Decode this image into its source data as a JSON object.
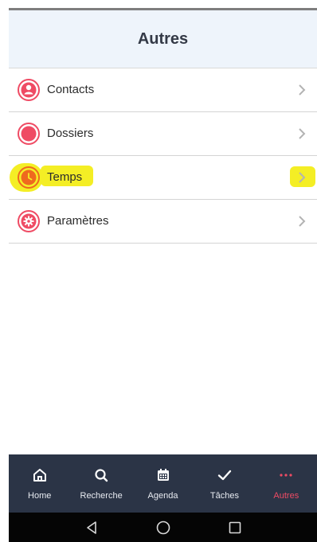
{
  "header": {
    "title": "Autres"
  },
  "menu": {
    "items": [
      {
        "label": "Contacts",
        "icon": "contacts-icon"
      },
      {
        "label": "Dossiers",
        "icon": "folder-icon"
      },
      {
        "label": "Temps",
        "icon": "clock-icon",
        "highlighted": true
      },
      {
        "label": "Paramètres",
        "icon": "settings-icon"
      }
    ]
  },
  "bottom_nav": {
    "items": [
      {
        "label": "Home",
        "icon": "home-icon"
      },
      {
        "label": "Recherche",
        "icon": "search-icon"
      },
      {
        "label": "Agenda",
        "icon": "calendar-icon"
      },
      {
        "label": "Tâches",
        "icon": "checkmark-icon"
      },
      {
        "label": "Autres",
        "icon": "more-dots-icon",
        "active": true
      }
    ]
  },
  "system_nav": {
    "buttons": [
      "back-icon",
      "home-circle-icon",
      "recents-icon"
    ]
  },
  "colors": {
    "accent": "#ef4b64",
    "nav_background": "#2b3446",
    "header_background": "#eef4fb",
    "highlight": "#f4ee25",
    "clock_orange": "#ef6a1e"
  }
}
